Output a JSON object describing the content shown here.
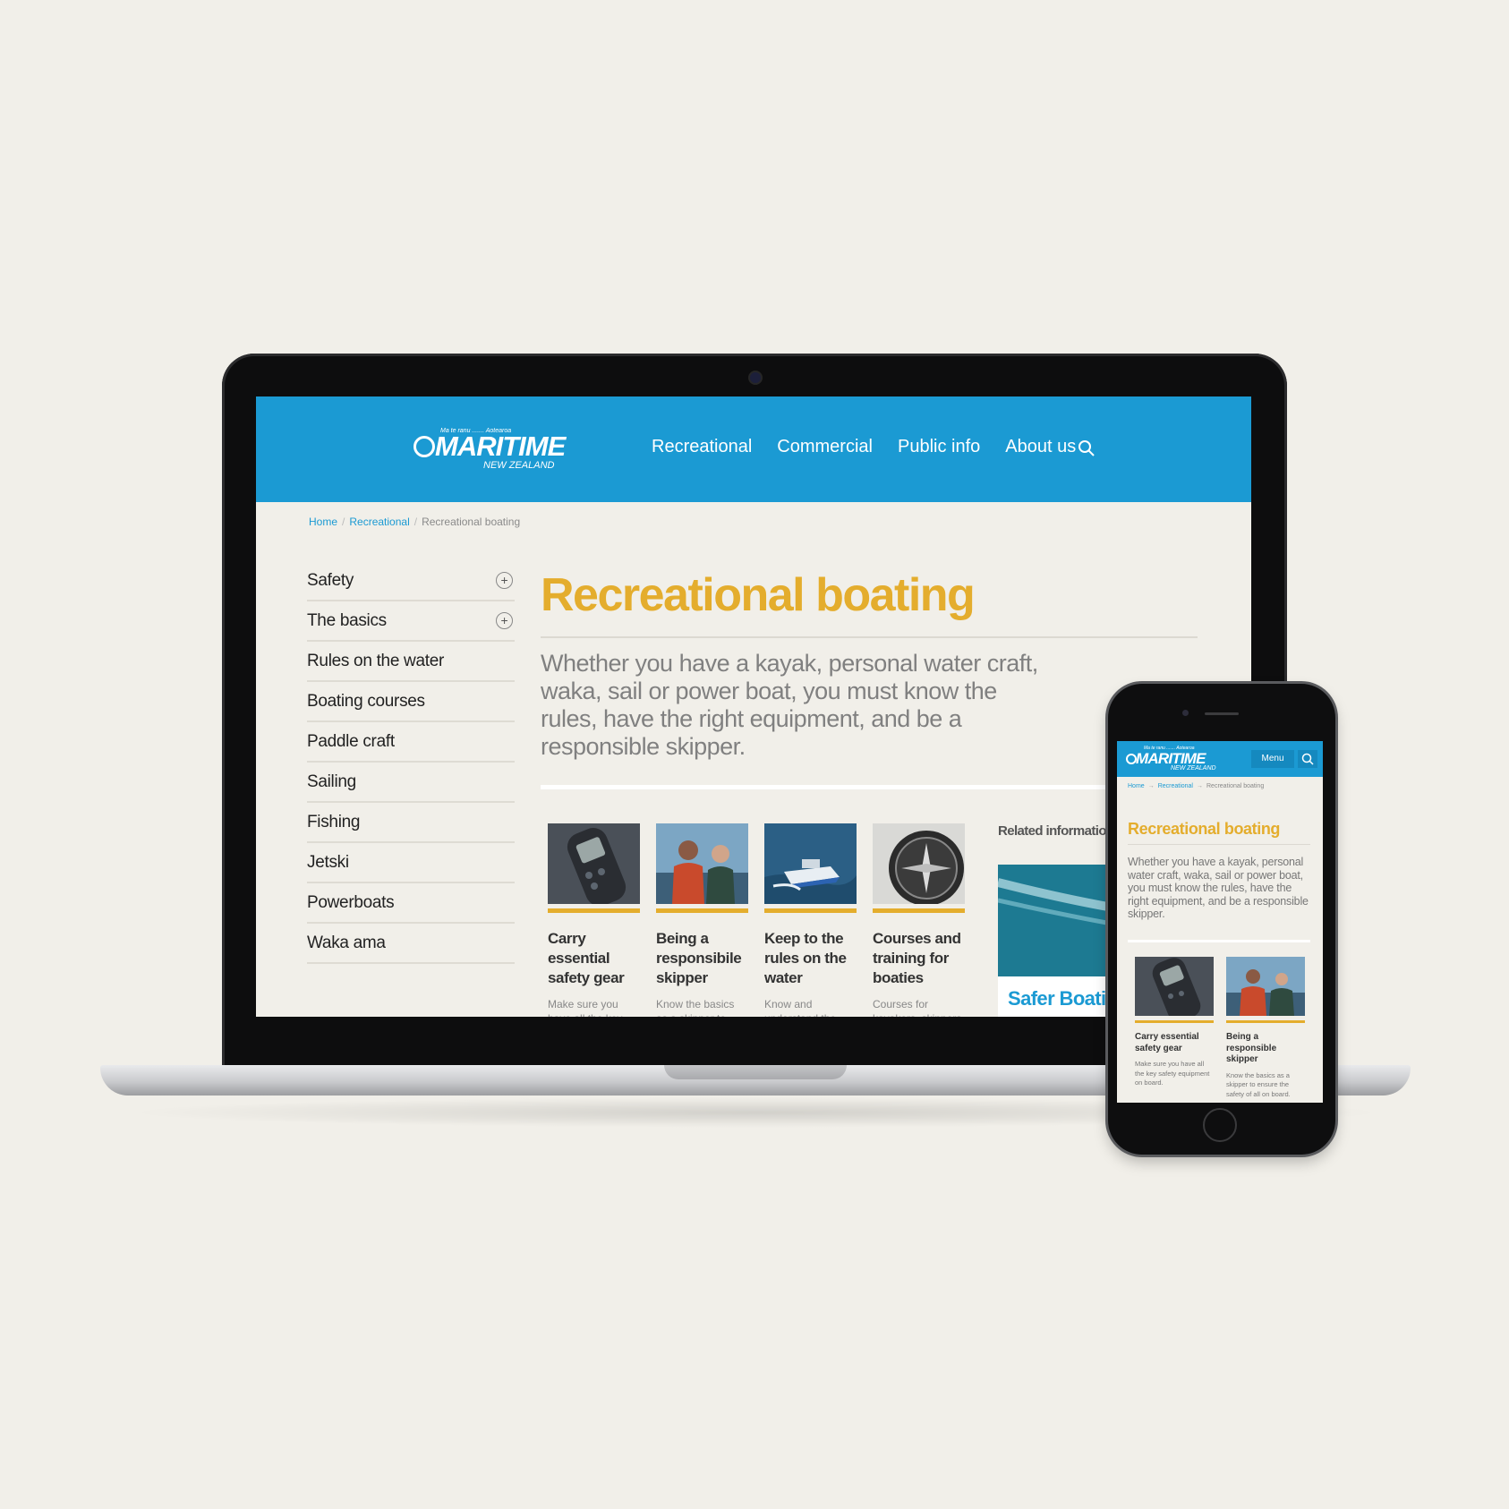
{
  "brand": {
    "tagline": "Ma te ranu ....... Aotearoa",
    "name": "MARITIME",
    "sub": "NEW ZEALAND",
    "primary_color": "#1b9ad3",
    "accent_color": "#e4ad2d"
  },
  "desktop": {
    "nav": [
      "Recreational",
      "Commercial",
      "Public info",
      "About us"
    ],
    "search_icon": "search-icon",
    "breadcrumb": {
      "home": "Home",
      "section": "Recreational",
      "current": "Recreational boating"
    },
    "sidebar": [
      {
        "label": "Safety",
        "expandable": true
      },
      {
        "label": "The basics",
        "expandable": true
      },
      {
        "label": "Rules on the water",
        "expandable": false
      },
      {
        "label": "Boating courses",
        "expandable": false
      },
      {
        "label": "Paddle craft",
        "expandable": false
      },
      {
        "label": "Sailing",
        "expandable": false
      },
      {
        "label": "Fishing",
        "expandable": false
      },
      {
        "label": "Jetski",
        "expandable": false
      },
      {
        "label": "Powerboats",
        "expandable": false
      },
      {
        "label": "Waka ama",
        "expandable": false
      }
    ],
    "title": "Recreational boating",
    "lead": "Whether you have a kayak, personal water craft, waka, sail or power boat, you must know the rules, have the right equipment, and be a responsible skipper.",
    "cards": [
      {
        "title": "Carry essential safety gear",
        "desc": "Make sure you have all the key safety"
      },
      {
        "title": "Being a responsibile skipper",
        "desc": "Know the basics as a skipper to ensure"
      },
      {
        "title": "Keep to the rules on the water",
        "desc": "Know and understand the rules"
      },
      {
        "title": "Courses and training for boaties",
        "desc": "Courses for kayakers, skippers"
      }
    ],
    "related_label": "Related information",
    "related_title": "Safer Boating"
  },
  "mobile": {
    "menu_label": "Menu",
    "breadcrumb": {
      "home": "Home",
      "section": "Recreational",
      "current": "Recreational boating"
    },
    "title": "Recreational boating",
    "lead": "Whether you have a kayak, personal water craft, waka, sail or power boat, you must know the rules, have the right equipment, and be a responsible skipper.",
    "cards": [
      {
        "title": "Carry essential safety gear",
        "desc": "Make sure you have all the key safety equipment on board."
      },
      {
        "title": "Being a responsible skipper",
        "desc": "Know the basics as a skipper to ensure the safety of all on board."
      }
    ]
  }
}
